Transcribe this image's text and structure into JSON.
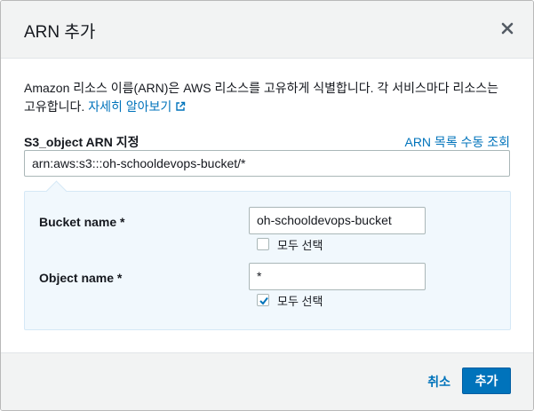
{
  "dialog": {
    "title": "ARN 추가",
    "close_icon": "close-icon"
  },
  "description": {
    "text": "Amazon 리소스 이름(ARN)은 AWS 리소스를 고유하게 식별합니다. 각 서비스마다 리소스는 고유합니다.",
    "learn_more": "자세히 알아보기",
    "learn_more_icon": "external-link-icon"
  },
  "arn": {
    "label": "S3_object ARN 지정",
    "manual_link": "ARN 목록 수동 조회",
    "value": "arn:aws:s3:::oh-schooldevops-bucket/*"
  },
  "fields": {
    "bucket": {
      "label": "Bucket name *",
      "value": "oh-schooldevops-bucket",
      "select_all": "모두 선택",
      "select_all_checked": false
    },
    "object": {
      "label": "Object name *",
      "value": "*",
      "select_all": "모두 선택",
      "select_all_checked": true
    }
  },
  "footer": {
    "cancel_label": "취소",
    "add_label": "추가"
  },
  "colors": {
    "link": "#0073bb",
    "primary_button": "#0073bb",
    "panel_bg": "#f1f8fd"
  }
}
